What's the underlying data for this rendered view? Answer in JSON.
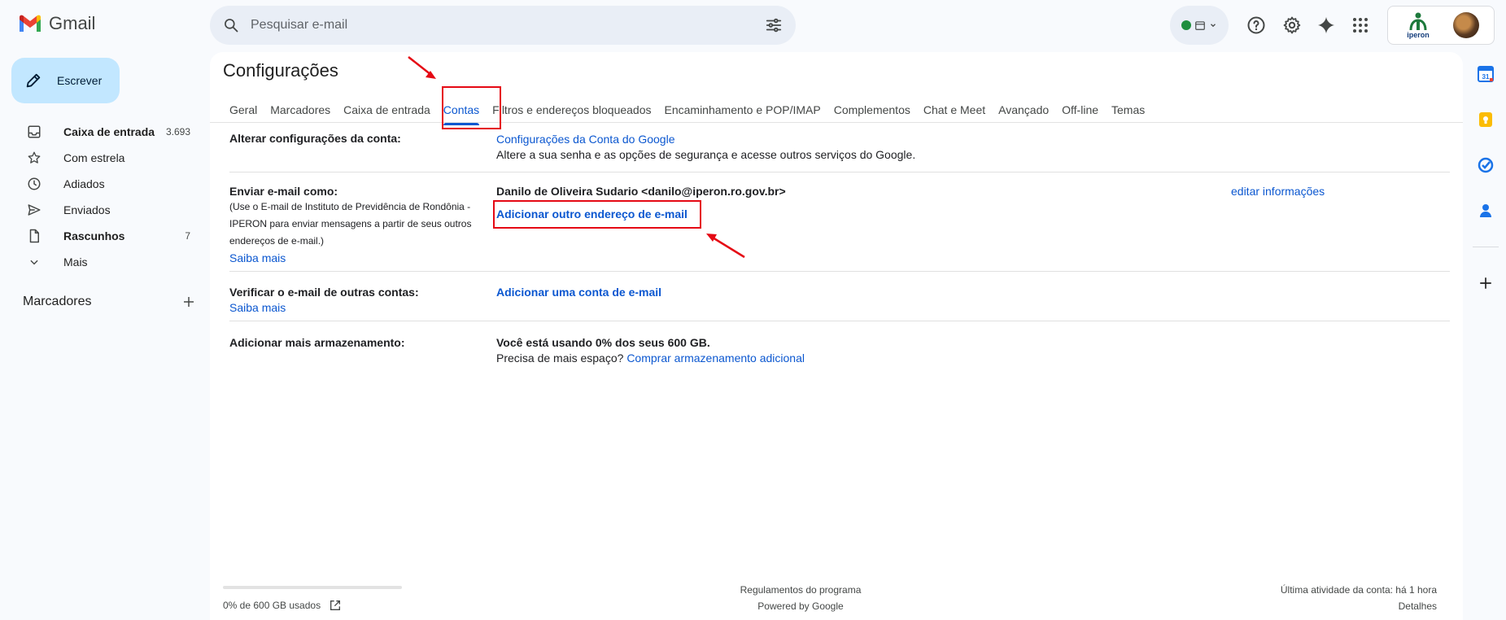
{
  "app": {
    "name": "Gmail"
  },
  "search": {
    "placeholder": "Pesquisar e-mail"
  },
  "nav": {
    "compose_label": "Escrever",
    "items": [
      {
        "label": "Caixa de entrada",
        "count": "3.693",
        "icon": "inbox-icon",
        "bold": true
      },
      {
        "label": "Com estrela",
        "count": "",
        "icon": "star-icon",
        "bold": false
      },
      {
        "label": "Adiados",
        "count": "",
        "icon": "clock-icon",
        "bold": false
      },
      {
        "label": "Enviados",
        "count": "",
        "icon": "send-icon",
        "bold": false
      },
      {
        "label": "Rascunhos",
        "count": "7",
        "icon": "draft-icon",
        "bold": true
      },
      {
        "label": "Mais",
        "count": "",
        "icon": "chevron-down-icon",
        "bold": false
      }
    ],
    "labels_title": "Marcadores"
  },
  "account": {
    "org_logo_text": "iperon"
  },
  "settings": {
    "title": "Configurações",
    "tabs": [
      "Geral",
      "Marcadores",
      "Caixa de entrada",
      "Contas",
      "Filtros e endereços bloqueados",
      "Encaminhamento e POP/IMAP",
      "Complementos",
      "Chat e Meet",
      "Avançado",
      "Off-line",
      "Temas"
    ],
    "active_tab": "Contas",
    "rows": {
      "change_account": {
        "label": "Alterar configurações da conta:",
        "link": "Configurações da Conta do Google",
        "desc": "Altere a sua senha e as opções de segurança e acesse outros serviços do Google."
      },
      "send_as": {
        "label": "Enviar e-mail como:",
        "note": "(Use o E-mail de Instituto de Previdência de Rondônia - IPERON para enviar mensagens a partir de seus outros endereços de e-mail.)",
        "learn_more": "Saiba mais",
        "identity": "Danilo de Oliveira Sudario <danilo@iperon.ro.gov.br>",
        "edit": "editar informações",
        "add_address": "Adicionar outro endereço de e-mail"
      },
      "check_mail": {
        "label": "Verificar o e-mail de outras contas:",
        "learn_more": "Saiba mais",
        "add_account": "Adicionar uma conta de e-mail"
      },
      "storage": {
        "label": "Adicionar mais armazenamento:",
        "usage": "Você está usando 0% dos seus 600 GB.",
        "need_more": "Precisa de mais espaço?",
        "buy": "Comprar armazenamento adicional"
      }
    }
  },
  "footer": {
    "storage_used": "0% de 600 GB usados",
    "storage_fraction": 0.0,
    "program_policies": "Regulamentos do programa",
    "powered_by": "Powered by Google",
    "last_activity": "Última atividade da conta: há 1 hora",
    "details": "Detalhes"
  },
  "colors": {
    "accent": "#0b57d0",
    "compose": "#c2e7ff",
    "annotation": "#e50914"
  }
}
